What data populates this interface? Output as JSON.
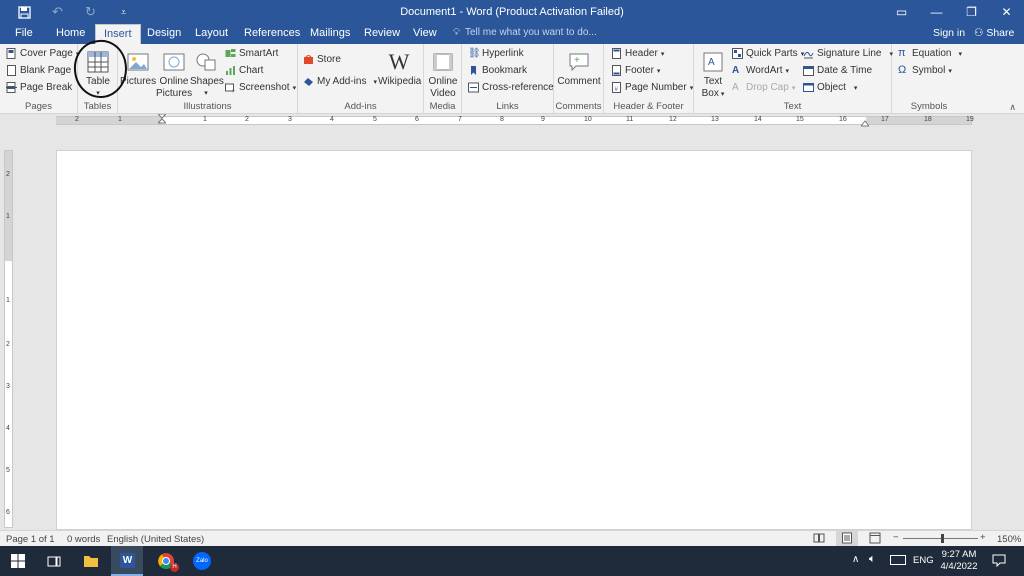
{
  "titlebar": {
    "doc_title": "Document1 - Word (Product Activation Failed)",
    "save_icon": "save-icon",
    "undo_icon": "undo-icon",
    "redo_icon": "redo-icon",
    "customize_icon": "customize-qat-icon"
  },
  "window_controls": {
    "ribbon_display": "▭",
    "minimize": "—",
    "restore": "❐",
    "close": "✕"
  },
  "tabs": [
    "File",
    "Home",
    "Insert",
    "Design",
    "Layout",
    "References",
    "Mailings",
    "Review",
    "View"
  ],
  "active_tab": "Insert",
  "tell_me": "Tell me what you want to do...",
  "sign_in": "Sign in",
  "share": "Share",
  "ribbon": {
    "pages": {
      "label": "Pages",
      "cover_page": "Cover Page",
      "blank_page": "Blank Page",
      "page_break": "Page Break"
    },
    "tables": {
      "label": "Tables",
      "table": "Table"
    },
    "illustrations": {
      "label": "Illustrations",
      "pictures": "Pictures",
      "online_pictures_1": "Online",
      "online_pictures_2": "Pictures",
      "shapes": "Shapes",
      "smartart": "SmartArt",
      "chart": "Chart",
      "screenshot": "Screenshot"
    },
    "addins": {
      "label": "Add-ins",
      "store": "Store",
      "my_addins": "My Add-ins",
      "wikipedia": "Wikipedia"
    },
    "media": {
      "label": "Media",
      "online_video_1": "Online",
      "online_video_2": "Video"
    },
    "links": {
      "label": "Links",
      "hyperlink": "Hyperlink",
      "bookmark": "Bookmark",
      "cross_reference": "Cross-reference"
    },
    "comments": {
      "label": "Comments",
      "comment": "Comment"
    },
    "header_footer": {
      "label": "Header & Footer",
      "header": "Header",
      "footer": "Footer",
      "page_number": "Page Number"
    },
    "text": {
      "label": "Text",
      "text_box_1": "Text",
      "text_box_2": "Box",
      "quick_parts": "Quick Parts",
      "wordart": "WordArt",
      "drop_cap": "Drop Cap",
      "signature_line": "Signature Line",
      "date_time": "Date & Time",
      "object": "Object"
    },
    "symbols": {
      "label": "Symbols",
      "equation": "Equation",
      "symbol": "Symbol"
    }
  },
  "ruler": {
    "h_ticks": [
      "2",
      "1",
      "1",
      "2",
      "3",
      "4",
      "5",
      "6",
      "7",
      "8",
      "9",
      "10",
      "11",
      "12",
      "13",
      "14",
      "15",
      "16",
      "17",
      "18",
      "19"
    ],
    "v_ticks": [
      "2",
      "1",
      "1",
      "2",
      "3",
      "4",
      "5",
      "6"
    ]
  },
  "status": {
    "page": "Page 1 of 1",
    "words": "0 words",
    "language": "English (United States)",
    "zoom": "150%",
    "zoom_out": "−",
    "zoom_in": "+"
  },
  "taskbar": {
    "time": "9:27 AM",
    "date": "4/4/2022",
    "language": "ENG",
    "zalo_label": "Zalo",
    "chrome_badge": "H"
  },
  "colors": {
    "word_blue": "#2b579a",
    "ribbon_bg": "#f3f3f3",
    "taskbar_bg": "#1f2b3a"
  }
}
